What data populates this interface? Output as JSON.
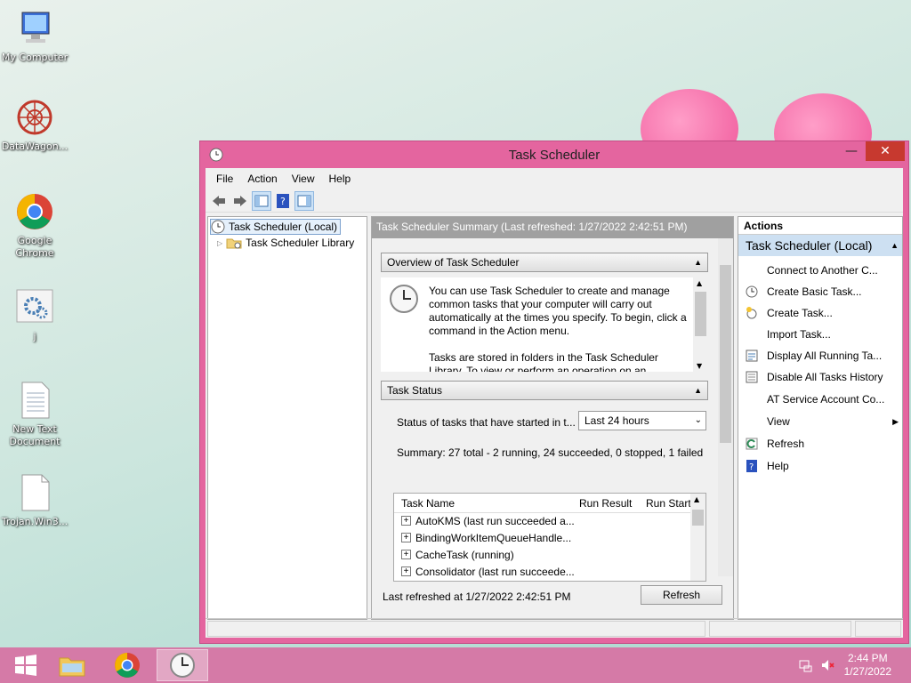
{
  "desktop": {
    "icons": [
      {
        "label": "My Computer",
        "icon": "computer-icon"
      },
      {
        "label": "DataWagon...",
        "icon": "datawagon-icon"
      },
      {
        "label": "Google Chrome",
        "icon": "chrome-icon"
      },
      {
        "label": "j",
        "icon": "settings-file-icon"
      },
      {
        "label": "New Text Document",
        "icon": "text-document-icon"
      },
      {
        "label": "Trojan.Win3...",
        "icon": "blank-file-icon"
      }
    ]
  },
  "window": {
    "title": "Task Scheduler",
    "menu": [
      "File",
      "Action",
      "View",
      "Help"
    ],
    "tree": {
      "root": "Task Scheduler (Local)",
      "child": "Task Scheduler Library"
    },
    "center": {
      "header": "Task Scheduler Summary (Last refreshed: 1/27/2022 2:42:51 PM)",
      "overview_title": "Overview of Task Scheduler",
      "overview_p1": "You can use Task Scheduler to create and manage common tasks that your computer will carry out automatically at the times you specify. To begin, click a command in the Action menu.",
      "overview_p2": "Tasks are stored in folders in the Task Scheduler Library. To view or perform an operation on an",
      "status_title": "Task Status",
      "status_label": "Status of tasks that have started in t...",
      "status_select": "Last 24 hours",
      "summary": "Summary: 27 total - 2 running, 24 succeeded, 0 stopped, 1 failed",
      "grid_headers": [
        "Task Name",
        "Run Result",
        "Run Start"
      ],
      "grid_rows": [
        "AutoKMS (last run succeeded a...",
        "BindingWorkItemQueueHandle...",
        "CacheTask (running)",
        "Consolidator (last run succeede..."
      ],
      "footer_label": "Last refreshed at 1/27/2022 2:42:51 PM",
      "refresh_button": "Refresh"
    },
    "actions": {
      "header": "Actions",
      "group": "Task Scheduler (Local)",
      "items": [
        {
          "label": "Connect to Another C...",
          "icon": ""
        },
        {
          "label": "Create Basic Task...",
          "icon": "create-basic-task-icon"
        },
        {
          "label": "Create Task...",
          "icon": "create-task-icon"
        },
        {
          "label": "Import Task...",
          "icon": ""
        },
        {
          "label": "Display All Running Ta...",
          "icon": "running-tasks-icon"
        },
        {
          "label": "Disable All Tasks History",
          "icon": "history-icon"
        },
        {
          "label": "AT Service Account Co...",
          "icon": ""
        },
        {
          "label": "View",
          "icon": ""
        },
        {
          "label": "Refresh",
          "icon": "refresh-icon"
        },
        {
          "label": "Help",
          "icon": "help-icon"
        }
      ]
    }
  },
  "taskbar": {
    "time": "2:44 PM",
    "date": "1/27/2022"
  },
  "colors": {
    "window_frame": "#e4659f",
    "close_button": "#c7392f",
    "taskbar": "#d57aa7"
  }
}
